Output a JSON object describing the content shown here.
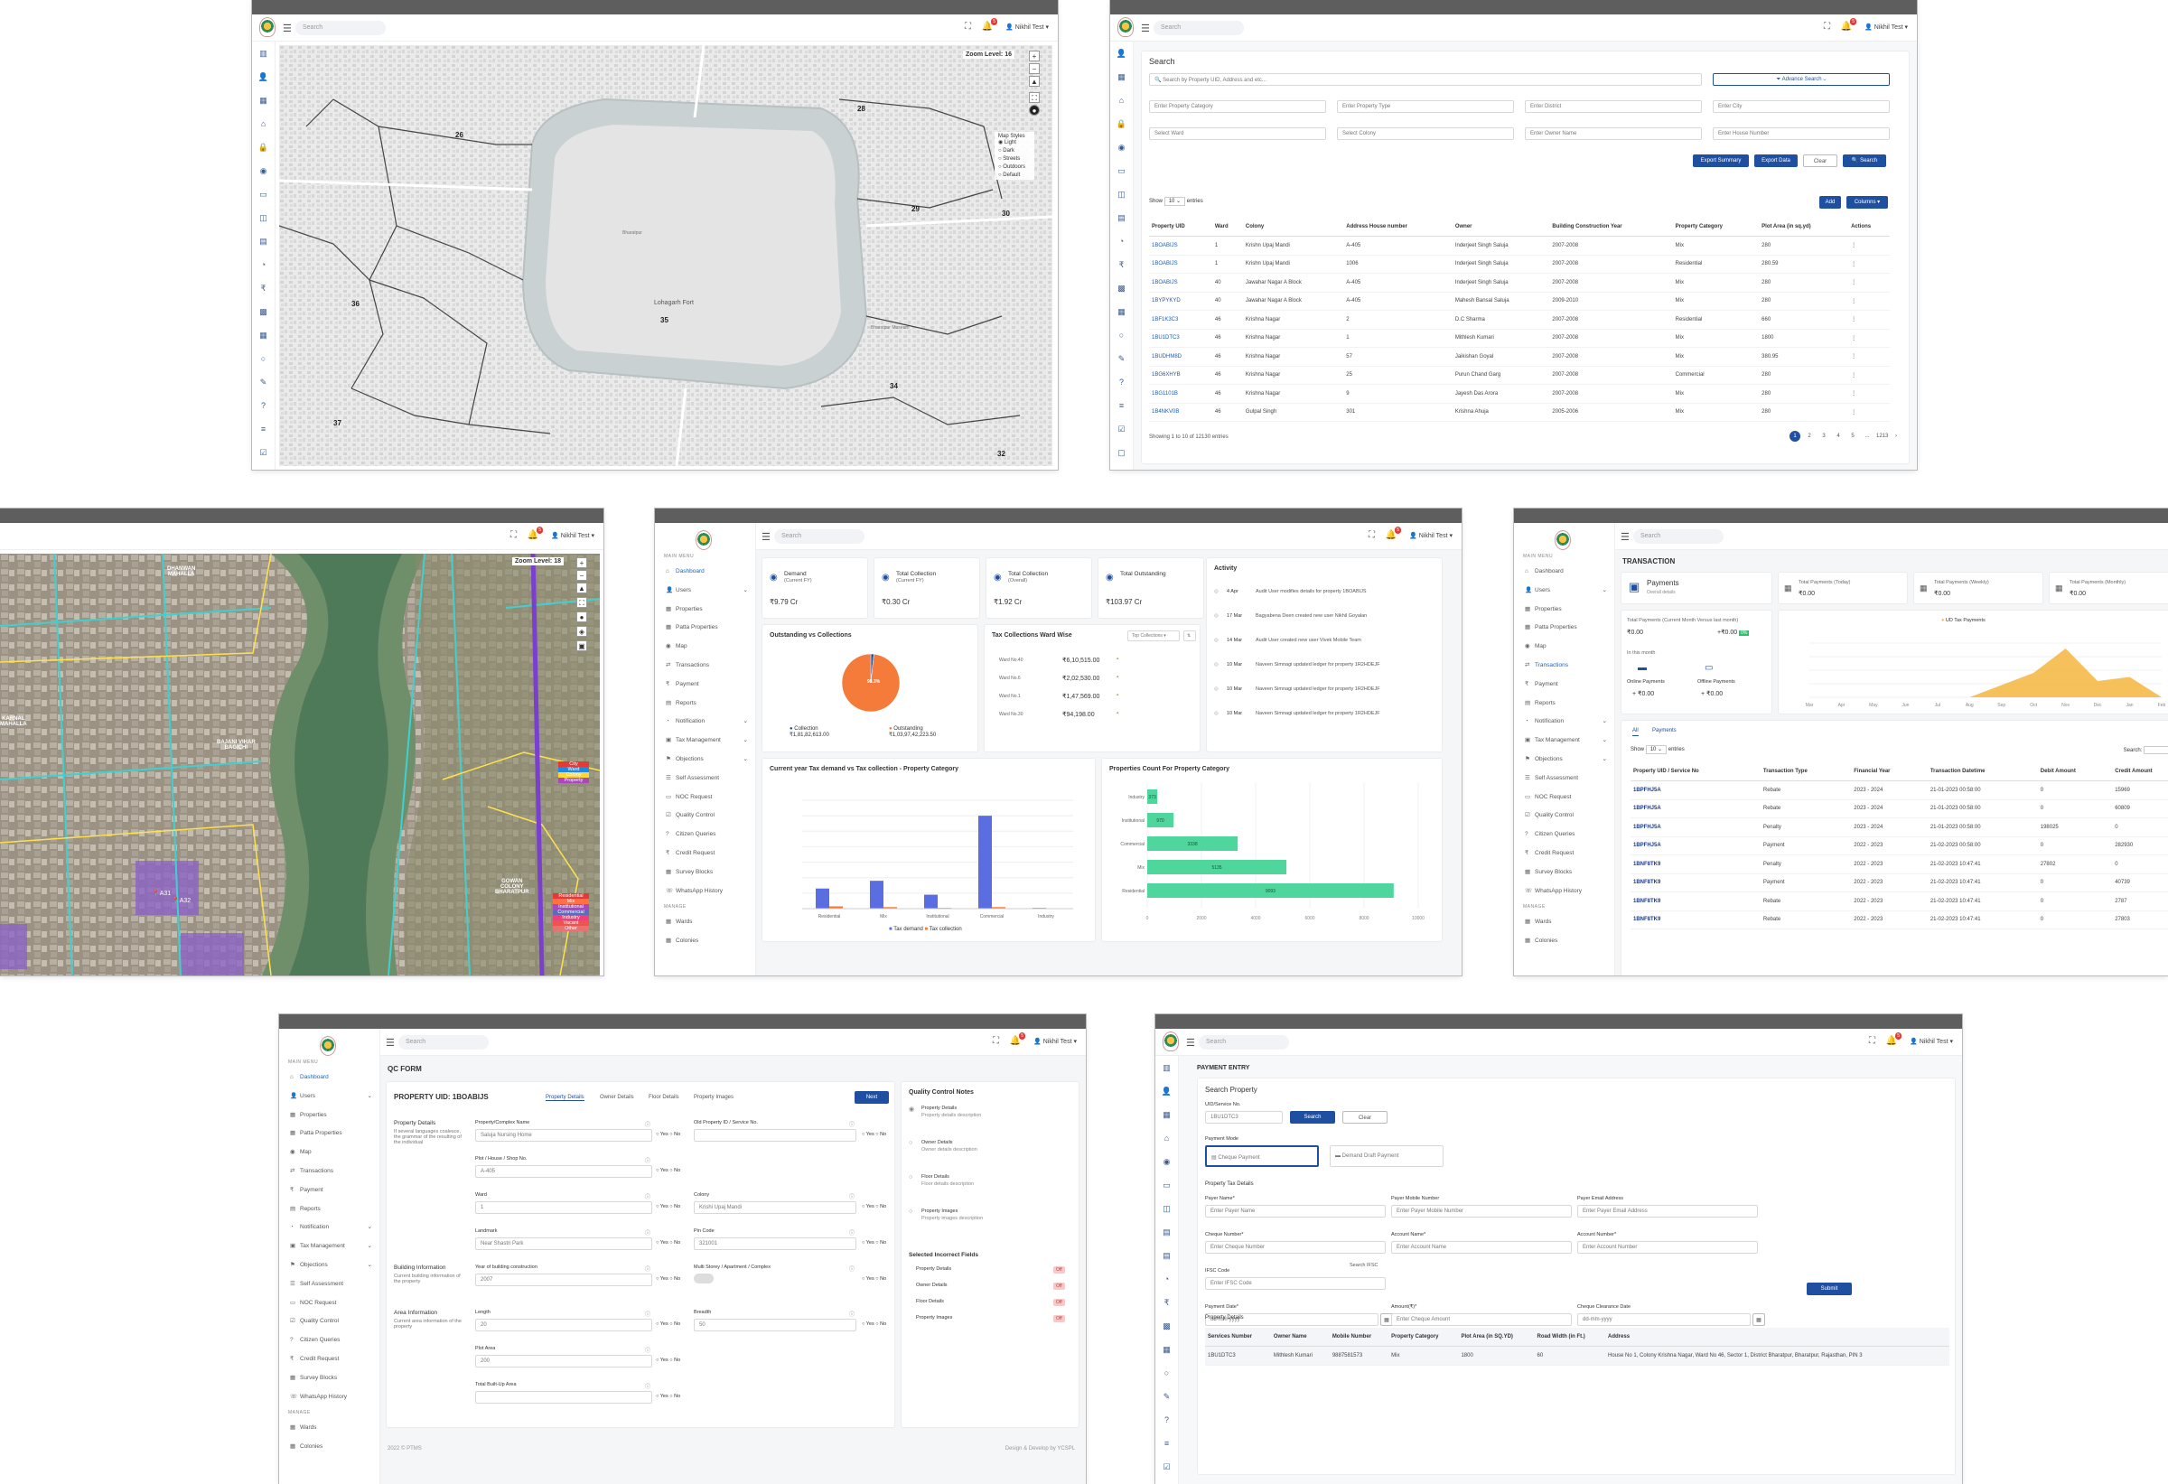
{
  "common": {
    "search": "Search",
    "user": "Nikhil Test",
    "badge": "5"
  },
  "map1": {
    "zoom": "Zoom Level: 16",
    "styles_title": "Map Styles",
    "styles": [
      "Light",
      "Dark",
      "Streets",
      "Outdoors",
      "Default"
    ],
    "wards": [
      "26",
      "28",
      "29",
      "30",
      "36",
      "35",
      "34",
      "37",
      "32"
    ],
    "labels": [
      "Lohagarh Fort",
      "Bharatpur Museum",
      "Bharatpur",
      "Lohagarh Fort"
    ]
  },
  "search": {
    "title": "Search",
    "search_ph": "Search by Property UID, Address and etc...",
    "advance": "Advance Search",
    "filters": [
      "Enter Property Category",
      "Enter Property Type",
      "Enter District",
      "Enter City",
      "Select Ward",
      "Select Colony",
      "Enter Owner Name",
      "Enter House Number"
    ],
    "btn_summary": "Export Summary",
    "btn_data": "Export Data",
    "btn_clear": "Clear",
    "btn_search": "Search",
    "show": "Show",
    "entries": "entries",
    "add": "Add",
    "columns": "Columns",
    "headers": [
      "Property UID",
      "Ward",
      "Colony",
      "Address House number",
      "Owner",
      "Building Construction Year",
      "Property Category",
      "Plot Area (in sq.yd)",
      "Actions"
    ],
    "rows": [
      [
        "1BOABIJS",
        "1",
        "Krishn Upaj Mandi",
        "A-405",
        "Inderjeet Singh Saluja",
        "2007-2008",
        "Mix",
        "280",
        "⋮"
      ],
      [
        "1BOABIJS",
        "1",
        "Krishn Upaj Mandi",
        "1006",
        "Inderjeet Singh Saluja",
        "2007-2008",
        "Residential",
        "280.59",
        "⋮"
      ],
      [
        "1BOABIJS",
        "40",
        "Jawahar Nagar A Block",
        "A-405",
        "Inderjeet Singh Saluja",
        "2007-2008",
        "Mix",
        "280",
        "⋮"
      ],
      [
        "1BYPYKYD",
        "40",
        "Jawahar Nagar A Block",
        "A-405",
        "Mahesh Bansal Saluja",
        "2009-2010",
        "Mix",
        "280",
        "⋮"
      ],
      [
        "1BF1K3C3",
        "46",
        "Krishna Nagar",
        "2",
        "D.C Sharma",
        "2007-2008",
        "Residential",
        "660",
        "⋮"
      ],
      [
        "1BU1DTC3",
        "46",
        "Krishna Nagar",
        "1",
        "Mithlesh Kumari",
        "2007-2008",
        "Mix",
        "1800",
        "⋮"
      ],
      [
        "1BUDHM8D",
        "46",
        "Krishna Nagar",
        "57",
        "Jaikishan Goyal",
        "2007-2008",
        "Mix",
        "380.95",
        "⋮"
      ],
      [
        "1BG6XHYB",
        "46",
        "Krishna Nagar",
        "25",
        "Purun Chand Garg",
        "2007-2008",
        "Commercial",
        "280",
        "⋮"
      ],
      [
        "1BG1101B",
        "46",
        "Krishna Nagar",
        "9",
        "Jayesh Das Arora",
        "2007-2008",
        "Mix",
        "280",
        "⋮"
      ],
      [
        "1B4NKV0B",
        "46",
        "Gulpal Singh",
        "301",
        "Krishna Ahuja",
        "2005-2006",
        "Mix",
        "280",
        "⋮"
      ]
    ],
    "showing": "Showing 1 to 10 of 12130 entries",
    "pages": [
      "1",
      "2",
      "3",
      "4",
      "5",
      "...",
      "1213",
      "›"
    ]
  },
  "map2": {
    "zoom": "Zoom Level: 18",
    "labels": [
      "DHANWAN",
      "MAHALLA",
      "BAJANI VIHAR",
      "BAGICHI",
      "KARNAL",
      "MAHALLA",
      "GOWAN",
      "COLONY",
      "BHARATPUR"
    ],
    "legend_top": [
      "City",
      "Ward",
      "Colony",
      "Property"
    ],
    "legend_bottom": [
      "Residential",
      "Mix",
      "Institutional",
      "Commercial",
      "Industry",
      "Vacant",
      "Other"
    ],
    "plots": [
      "A31",
      "A32",
      "A2",
      "A3",
      "A4"
    ]
  },
  "dash": {
    "menu_title": "MAIN MENU",
    "manage": "MANAGE",
    "stats": [
      {
        "label": "Demand",
        "sub": "(Current FY)",
        "value": "₹9.79 Cr"
      },
      {
        "label": "Total Collection",
        "sub": "(Current FY)",
        "value": "₹0.30 Cr"
      },
      {
        "label": "Total Collection",
        "sub": "(Overall)",
        "value": "₹1.92 Cr"
      },
      {
        "label": "Total Outstanding",
        "sub": "",
        "value": "₹103.97 Cr"
      }
    ],
    "activity_title": "Activity",
    "activity": [
      [
        "4 Apr",
        "Audit User modifies details for property 1BOABIJS"
      ],
      [
        "17 Mar",
        "Bagyabena Deen created new user Nikhil Goyalan"
      ],
      [
        "14 Mar",
        "Audit User created new user Vivek Mobile Team"
      ],
      [
        "10 Mar",
        "Naveen Simnagi updated ledger for property 1R2HDEJF"
      ],
      [
        "10 Mar",
        "Naveen Simnagi updated ledger for property 1R2HDEJF"
      ],
      [
        "10 Mar",
        "Naveen Simnagi updated ledger for property 1R2HDEJF"
      ]
    ],
    "pie_title": "Outstanding vs Collections",
    "pie_pct": "98.3%",
    "pie_left": "Collection",
    "pie_left_val": "₹1,81,82,613.00",
    "pie_right": "Outstanding",
    "pie_right_val": "₹1,03,97,42,223.50",
    "ward_title": "Tax Collections Ward Wise",
    "ward_btn": "Top Collections",
    "wards": [
      [
        "Ward No.40",
        "₹6,10,515.00"
      ],
      [
        "Ward No.6",
        "₹2,02,530.00"
      ],
      [
        "Ward No.1",
        "₹1,47,569.00"
      ],
      [
        "Ward No.30",
        "₹94,198.00"
      ]
    ],
    "bar_title": "Current year Tax demand vs Tax collection - Property Category",
    "bar_legend": [
      "Tax demand",
      "Tax collection"
    ],
    "prop_title": "Properties Count For Property Category"
  },
  "chart_data": [
    {
      "type": "bar",
      "title": "Current year Tax demand vs Tax collection - Property Category",
      "categories": [
        "Residential",
        "Mix",
        "Institutional",
        "Commercial",
        "Industry"
      ],
      "series": [
        {
          "name": "Tax demand",
          "values": [
            1.3,
            1.8,
            0.9,
            6.0,
            0.05
          ]
        },
        {
          "name": "Tax collection",
          "values": [
            0.15,
            0.1,
            0.05,
            0.1,
            0.0
          ]
        }
      ]
    },
    {
      "type": "bar",
      "title": "Properties Count For Property Category",
      "categories": [
        "Industry",
        "Institutional",
        "Commercial",
        "Mix",
        "Residential"
      ],
      "values": [
        373,
        970,
        3338,
        5135,
        9093
      ],
      "labels": [
        "373",
        "970",
        "3338",
        "5135",
        "9093"
      ],
      "xlim": [
        0,
        10000
      ],
      "xticks": [
        "0",
        "2000",
        "4000",
        "6000",
        "8000",
        "10000"
      ]
    },
    {
      "type": "pie",
      "title": "Outstanding vs Collections",
      "categories": [
        "Collection",
        "Outstanding"
      ],
      "values": [
        1.7,
        98.3
      ]
    },
    {
      "type": "area",
      "series": [
        {
          "name": "UD Tax Payments"
        }
      ],
      "categories": [
        "Mar",
        "Apr",
        "May",
        "Jun",
        "Jul",
        "Aug",
        "Sep",
        "Oct",
        "Nov",
        "Dec",
        "Jan",
        "Feb"
      ],
      "values": [
        0,
        0,
        0,
        0,
        0,
        0,
        0.9,
        1.8,
        3.6,
        1.2,
        1.5,
        0
      ]
    }
  ],
  "trans": {
    "title": "TRANSACTION",
    "payments": "Payments",
    "overall": "Overall details",
    "cards": [
      [
        "Total Payments (Today)",
        "₹0.00"
      ],
      [
        "Total Payments (Weekly)",
        "₹0.00"
      ],
      [
        "Total Payments (Monthly)",
        "₹0.00"
      ]
    ],
    "month_label": "Total Payments (Current Month Versus last month)",
    "month_val": "₹0.00",
    "diff": "+₹0.00",
    "this_month": "In this month",
    "online": "Online Payments",
    "offline": "Offline Payments",
    "online_v": "+ ₹0.00",
    "offline_v": "+ ₹0.00",
    "chart_legend": "UD Tax Payments",
    "tabs": [
      "All",
      "Payments"
    ],
    "search_label": "Search:",
    "headers": [
      "Property UID / Service No",
      "Transaction Type",
      "Financial Year",
      "Transaction Datetime",
      "Debit Amount",
      "Credit Amount"
    ],
    "rows": [
      [
        "1BPFHJ5A",
        "Rebate",
        "2023 - 2024",
        "21-01-2023 00:58:00",
        "0",
        "15969"
      ],
      [
        "1BPFHJ5A",
        "Rebate",
        "2023 - 2024",
        "21-01-2023 00:58:00",
        "0",
        "60809"
      ],
      [
        "1BPFHJ5A",
        "Penalty",
        "2023 - 2024",
        "21-01-2023 00:58:00",
        "198025",
        "0"
      ],
      [
        "1BPFHJ5A",
        "Payment",
        "2022 - 2023",
        "21-02-2023 00:58:00",
        "0",
        "282930"
      ],
      [
        "1BNF8TK9",
        "Penalty",
        "2022 - 2023",
        "21-02-2023 10:47:41",
        "27802",
        "0"
      ],
      [
        "1BNF8TK9",
        "Payment",
        "2022 - 2023",
        "21-02-2023 10:47:41",
        "0",
        "40739"
      ],
      [
        "1BNF8TK9",
        "Rebate",
        "2022 - 2023",
        "21-02-2023 10:47:41",
        "0",
        "2787"
      ],
      [
        "1BNF8TK9",
        "Rebate",
        "2022 - 2023",
        "21-02-2023 10:47:41",
        "0",
        "27803"
      ]
    ]
  },
  "qc": {
    "title": "QC FORM",
    "uid": "PROPERTY UID: 1BOABIJS",
    "tabs": [
      "Property Details",
      "Owner Details",
      "Floor Details",
      "Property Images"
    ],
    "next": "Next",
    "sec1": "Property Details",
    "sec1_desc": "If several languages coalesce, the grammar of the resulting of the individual",
    "sec2": "Building Information",
    "sec2_desc": "Current building information of the property",
    "sec3": "Area Information",
    "sec3_desc": "Current area information of the property",
    "fields": [
      [
        "Property/Complex Name",
        "Saluja Nursing Home"
      ],
      [
        "Plot / House / Shop No.",
        "A-405"
      ],
      [
        "Ward",
        "1"
      ],
      [
        "Landmark",
        "Near Shastri Park"
      ],
      [
        "Year of building construction",
        "2007"
      ],
      [
        "Length",
        "20"
      ],
      [
        "Plot Area",
        "200"
      ],
      [
        "Total Built-Up Area",
        ""
      ]
    ],
    "fields2": [
      [
        "Old Property ID / Service No.",
        ""
      ],
      [
        "Colony",
        "Krishi Upaj Mandi"
      ],
      [
        "Pin Code",
        "321001"
      ],
      [
        "Multi Storey / Apartment / Complex",
        "false"
      ],
      [
        "Breadth",
        "50"
      ]
    ],
    "yes": "Yes",
    "no": "No",
    "notes_title": "Quality Control Notes",
    "notes": [
      [
        "Property Details",
        "Property details description"
      ],
      [
        "Owner Details",
        "Owner details description"
      ],
      [
        "Floor Details",
        "Floor details description"
      ],
      [
        "Property Images",
        "Property images description"
      ]
    ],
    "incorrect_title": "Selected Incorrect Fields",
    "incorrect": [
      "Property Details",
      "Owner Details",
      "Floor Details",
      "Property Images"
    ],
    "off": "Off",
    "footer_l": "2022 © PTMS",
    "footer_r": "Design & Develop by YCSPL"
  },
  "pay": {
    "title": "PAYMENT ENTRY",
    "search_prop": "Search Property",
    "uid_label": "UID/Service No.",
    "uid_val": "1BU1DTC3",
    "search": "Search",
    "clear": "Clear",
    "mode_label": "Payment Mode",
    "mode1": "Cheque Payment",
    "mode2": "Demand Draft Payment",
    "tax_details": "Property Tax Details",
    "f": [
      [
        "Payer Name*",
        "Enter Payer Name"
      ],
      [
        "Payer Mobile Number",
        "Enter Payer Mobile Number"
      ],
      [
        "Payer Email Address",
        "Enter Payer Email Address"
      ],
      [
        "Cheque Number*",
        "Enter Cheque Number"
      ],
      [
        "Account Name*",
        "Enter Account Name"
      ],
      [
        "Account Number*",
        "Enter Account Number"
      ],
      [
        "IFSC Code",
        "Enter IFSC Code"
      ],
      [
        "Payment Date*",
        "dd-mm-yyyy"
      ],
      [
        "Amount(₹)*",
        "Enter Cheque Amount"
      ],
      [
        "Cheque Clearance Date",
        "dd-mm-yyyy"
      ]
    ],
    "search_ifsc": "Search IFSC",
    "submit": "Submit",
    "prop_details": "Property Details",
    "headers": [
      "Services Number",
      "Owner Name",
      "Mobile Number",
      "Property Category",
      "Plot Area (in SQ.YD)",
      "Road Width (in Ft.)",
      "Address"
    ],
    "row": [
      "1BU1DTC3",
      "Mithlesh Kumari",
      "9887581573",
      "Mix",
      "1800",
      "60",
      "House No 1, Colony Krishna Nagar, Ward No 46, Sector 1, District Bharatpur, Bharatpur, Rajasthan, PIN 3"
    ]
  },
  "menu": [
    "Dashboard",
    "Users",
    "Properties",
    "Patta Properties",
    "Map",
    "Transactions",
    "Payment",
    "Reports",
    "Notification",
    "Tax Management",
    "Objections",
    "Self Assessment",
    "NOC Request",
    "Quality Control",
    "Citizen Queries",
    "Credit Request",
    "Survey Blocks",
    "WhatsApp History"
  ],
  "manage_menu": [
    "Wards",
    "Colonies"
  ]
}
